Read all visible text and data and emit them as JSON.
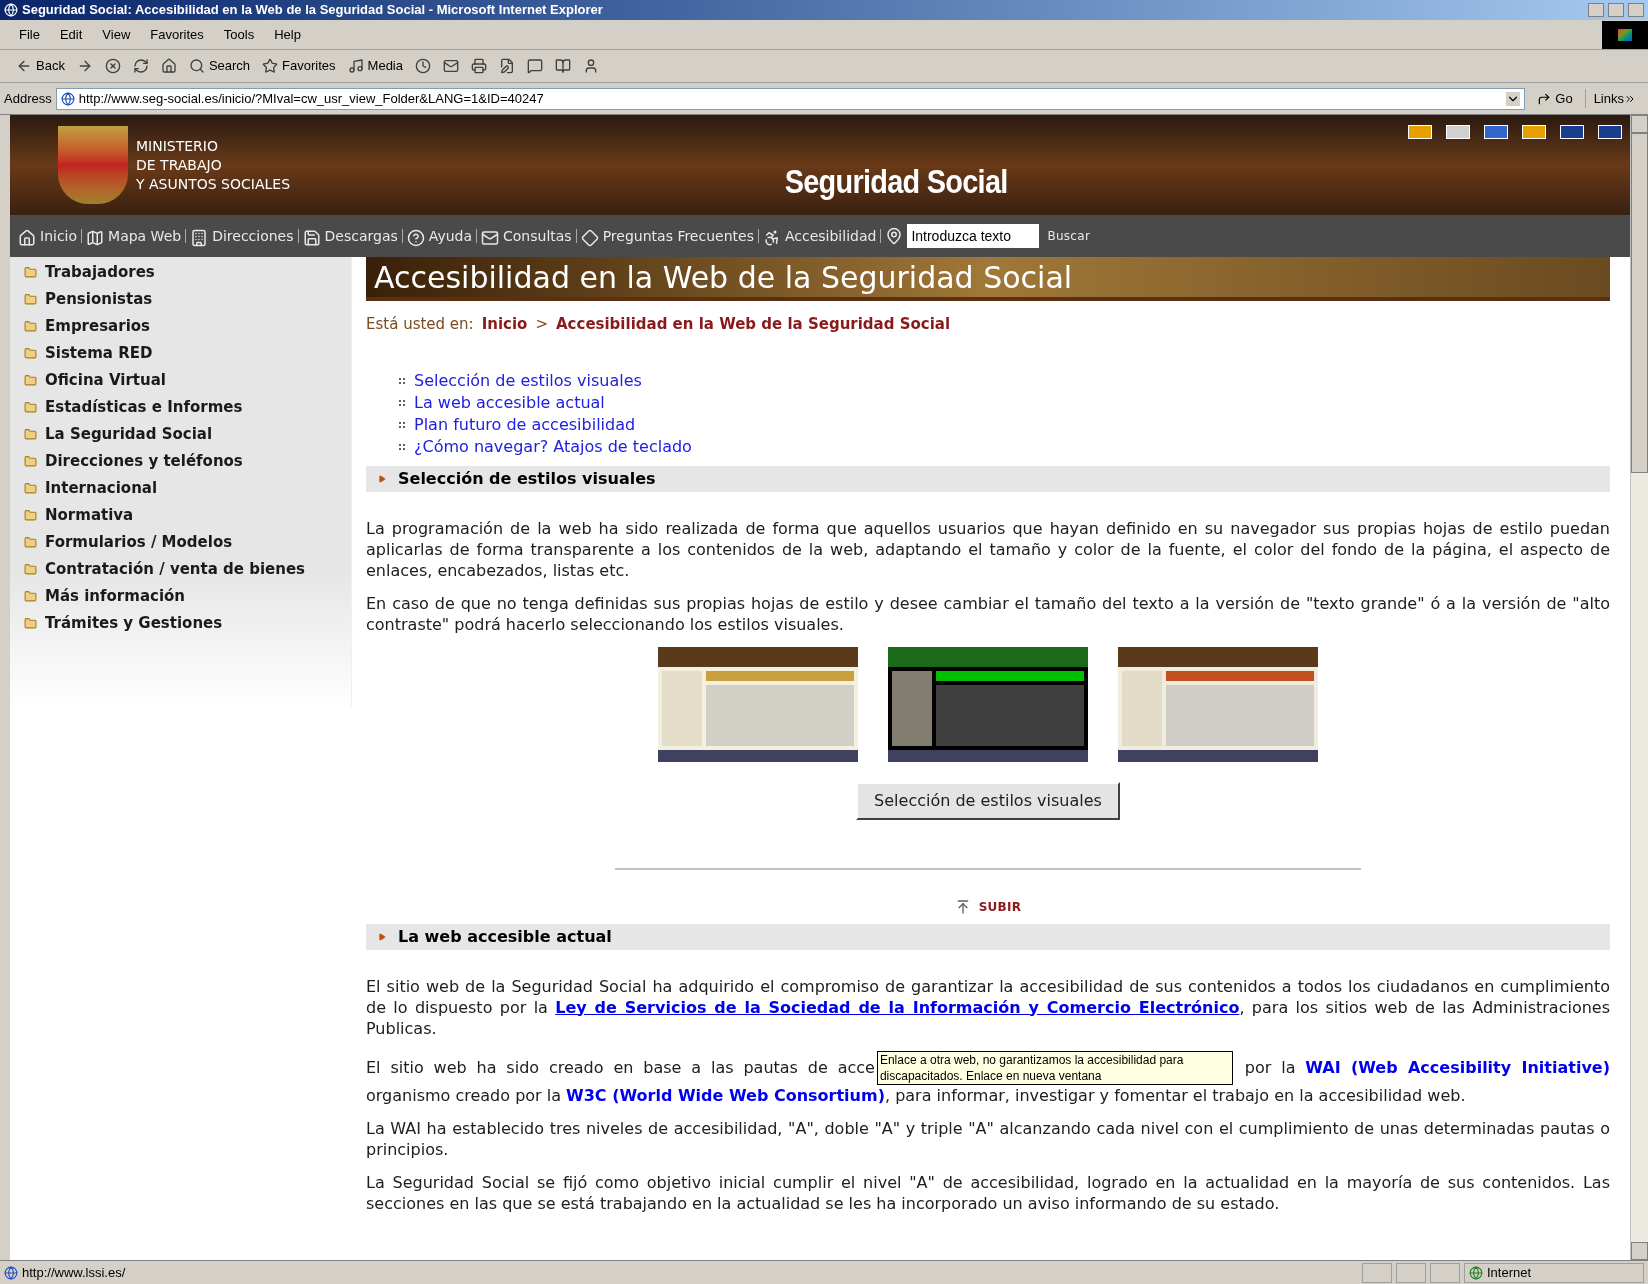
{
  "window": {
    "title": "Seguridad Social: Accesibilidad en la Web de la Seguridad Social - Microsoft Internet Explorer"
  },
  "menu": [
    "File",
    "Edit",
    "View",
    "Favorites",
    "Tools",
    "Help"
  ],
  "toolbar": [
    {
      "kind": "back",
      "label": "Back"
    },
    {
      "kind": "forward"
    },
    {
      "kind": "stop"
    },
    {
      "kind": "refresh"
    },
    {
      "kind": "home"
    },
    {
      "kind": "search",
      "label": "Search"
    },
    {
      "kind": "favorites",
      "label": "Favorites"
    },
    {
      "kind": "media",
      "label": "Media"
    },
    {
      "kind": "history"
    },
    {
      "kind": "mail"
    },
    {
      "kind": "print"
    },
    {
      "kind": "edit"
    },
    {
      "kind": "discuss"
    },
    {
      "kind": "research"
    },
    {
      "kind": "messenger"
    }
  ],
  "address": {
    "label": "Address",
    "url": "http://www.seg-social.es/inicio/?MIval=cw_usr_view_Folder&LANG=1&ID=40247",
    "go": "Go",
    "links": "Links"
  },
  "header": {
    "ministry": [
      "MINISTERIO",
      "DE TRABAJO",
      "Y ASUNTOS SOCIALES"
    ],
    "site_title": "Seguridad Social",
    "flags": [
      {
        "color": "#e8a000"
      },
      {
        "color": "#d0d0d0"
      },
      {
        "color": "#3366cc"
      },
      {
        "color": "#e8a000"
      },
      {
        "color": "#1a3d8f"
      },
      {
        "color": "#1a3d8f"
      }
    ]
  },
  "nav": {
    "items": [
      "Inicio",
      "Mapa Web",
      "Direcciones",
      "Descargas",
      "Ayuda",
      "Consultas",
      "Preguntas Frecuentes",
      "Accesibilidad"
    ],
    "search_placeholder": "Introduzca texto",
    "search_button": "Buscar"
  },
  "sidebar": {
    "items": [
      "Trabajadores",
      "Pensionistas",
      "Empresarios",
      "Sistema RED",
      "Oficina Virtual",
      "Estadísticas e Informes",
      "La Seguridad Social",
      "Direcciones y teléfonos",
      "Internacional",
      "Normativa",
      "Formularios / Modelos",
      "Contratación / venta de bienes",
      "Más información",
      "Trámites y Gestiones"
    ]
  },
  "page_title": "Accesibilidad en la Web de la Seguridad Social",
  "breadcrumb": {
    "label": "Está usted en:",
    "items": [
      "Inicio",
      "Accesibilidad en la Web de la Seguridad Social"
    ],
    "separator": ">"
  },
  "toc": [
    "Selección de estilos visuales",
    "La web accesible actual",
    "Plan futuro de accesibilidad",
    "¿Cómo navegar? Atajos de teclado"
  ],
  "sections": [
    {
      "heading": "Selección de estilos visuales",
      "paragraphs": [
        [
          {
            "kind": "text",
            "text": "La programación de la web ha sido realizada de forma que aquellos usuarios que hayan definido en su navegador sus propias hojas de estilo puedan aplicarlas de forma transparente a los contenidos de la web, adaptando el tamaño y color de la fuente, el color del fondo de la página, el aspecto de enlaces, encabezados, listas etc."
          }
        ],
        [
          {
            "kind": "text",
            "text": "En caso de que no tenga definidas sus propias hojas de estilo y desee cambiar el tamaño del texto a la versión de \"texto grande\" ó a la versión de \"alto contraste\" podrá hacerlo seleccionando los estilos visuales."
          }
        ]
      ],
      "thumbnails": [
        {
          "kind": "normal"
        },
        {
          "kind": "contrast"
        },
        {
          "kind": "large"
        }
      ],
      "button": "Selección de estilos visuales",
      "back_to_top": "SUBIR"
    },
    {
      "heading": "La web accesible actual",
      "paragraphs": [
        [
          {
            "kind": "text",
            "text": "El sitio web de la Seguridad Social ha adquirido el compromiso de garantizar la accesibilidad de sus contenidos a todos los ciudadanos en cumplimiento de lo dispuesto por la "
          },
          {
            "kind": "underlined_link",
            "text": "Ley de Servicios de la Sociedad de la Información y Comercio Electrónico"
          },
          {
            "kind": "text",
            "text": ", para los sitios web de las Administraciones Publicas."
          }
        ],
        [
          {
            "kind": "text",
            "text": "El sitio web ha sido creado en base a las pautas  de acce"
          },
          {
            "kind": "tooltip",
            "text": "Enlace a otra web, no garantizamos la accesibilidad para discapacitados. Enlace en nueva ventana"
          },
          {
            "kind": "text",
            "text": " por la "
          },
          {
            "kind": "link",
            "text": "WAI (Web Accesibility Initiative)"
          },
          {
            "kind": "text",
            "text": " organismo creado por la "
          },
          {
            "kind": "link",
            "text": "W3C (World Wide Web Consortium)"
          },
          {
            "kind": "text",
            "text": ", para informar, investigar y fomentar el trabajo en la accesibilidad web."
          }
        ],
        [
          {
            "kind": "text",
            "text": "La WAI ha establecido tres niveles de accesibilidad, \"A\", doble \"A\" y triple \"A\" alcanzando cada nivel con el cumplimiento de unas determinadas pautas o principios."
          }
        ],
        [
          {
            "kind": "text",
            "text": "La Seguridad Social se fijó como objetivo inicial cumplir el nivel \"A\" de accesibilidad, logrado en la actualidad en la mayoría de sus contenidos. Las secciones en las que se está trabajando en la actualidad se les ha incorporado un aviso informando de su estado."
          }
        ]
      ]
    }
  ],
  "status_bar": {
    "url": "http://www.lssi.es/",
    "zone": "Internet"
  }
}
